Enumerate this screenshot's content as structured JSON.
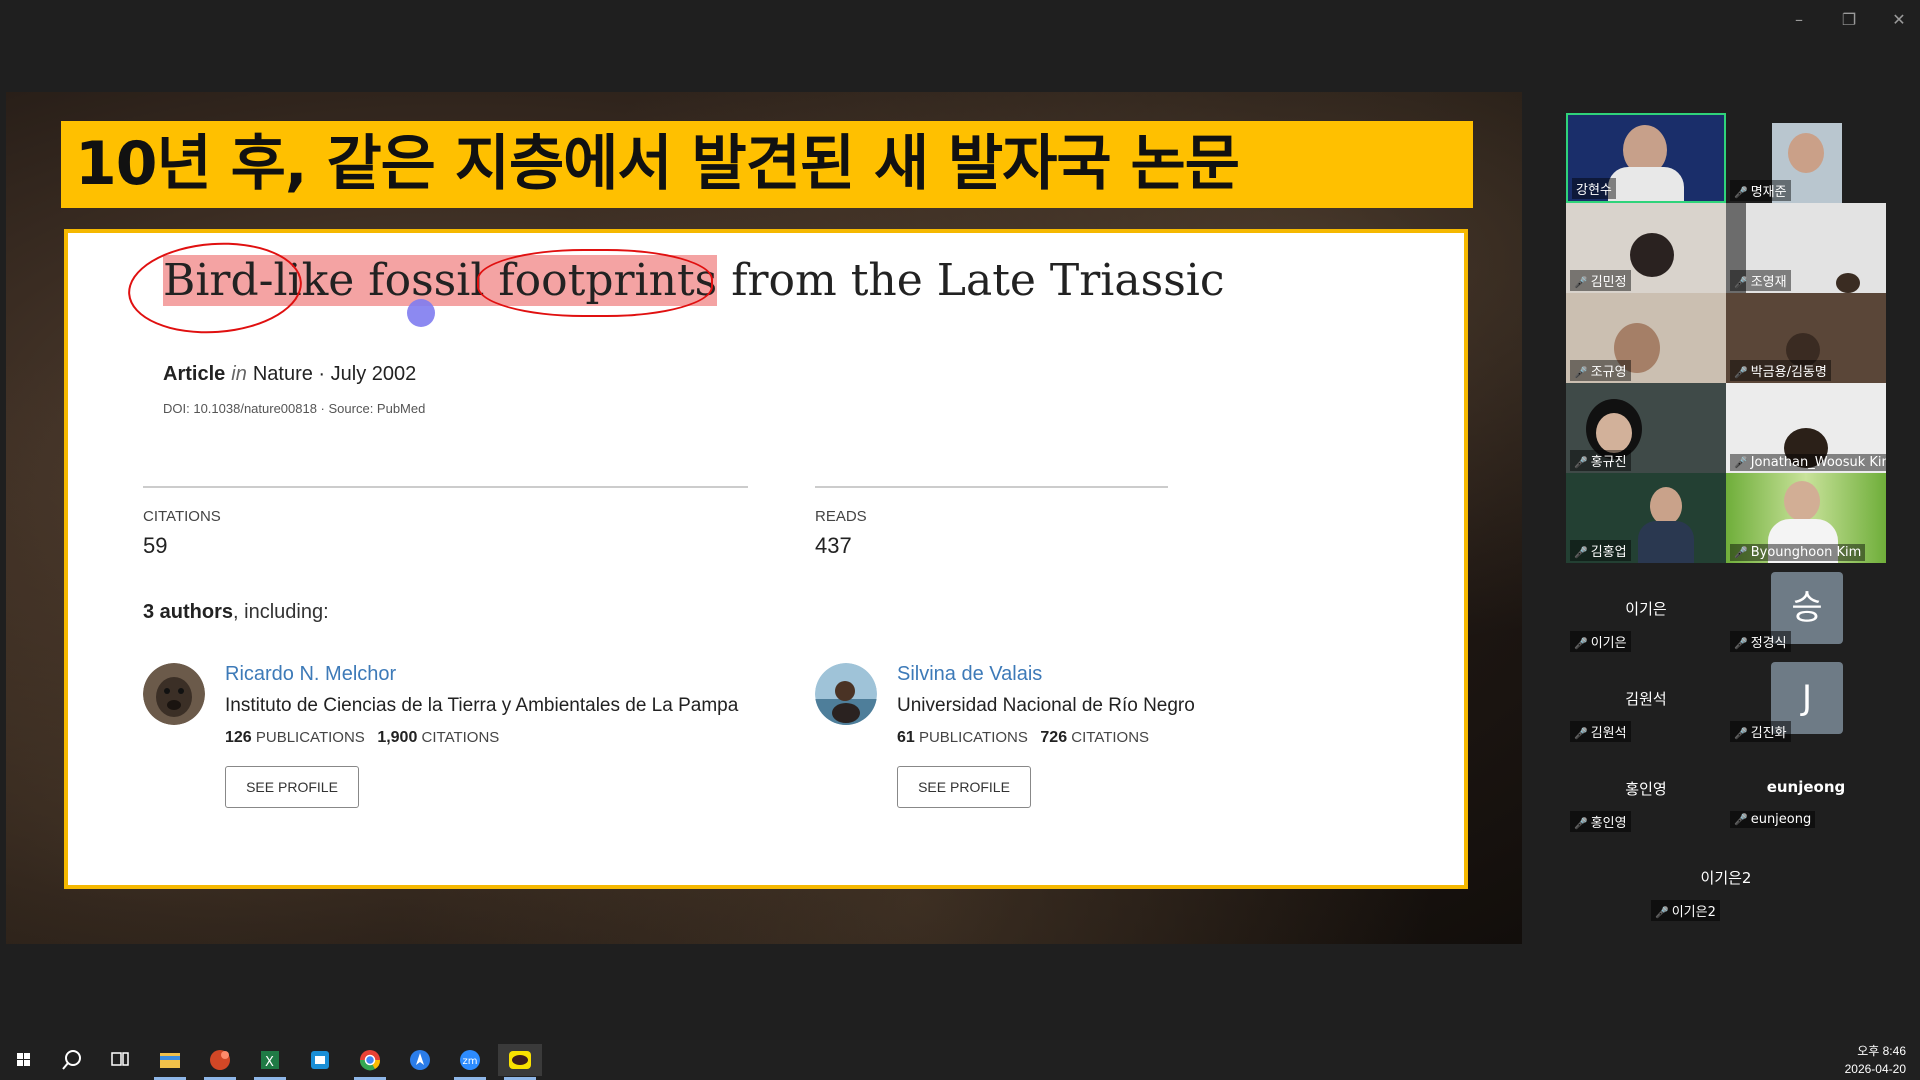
{
  "window": {
    "minimize": "–",
    "restore": "❐",
    "close": "✕"
  },
  "slide": {
    "banner": "10년 후, 같은 지층에서 발견된 새 발자국 논문",
    "title_part1": "Bird-like fossil",
    "title_part2": "footprints",
    "title_part3": " from the Late Triassic",
    "type": "Article",
    "in": "in",
    "journal": "Nature · July 2002",
    "doi": "DOI: 10.1038/nature00818 · Source: PubMed",
    "citations_label": "CITATIONS",
    "citations_value": "59",
    "reads_label": "READS",
    "reads_value": "437",
    "authors_count": "3 authors",
    "authors_suffix": ", including:",
    "authors": [
      {
        "name": "Ricardo N. Melchor",
        "institution": "Instituto de Ciencias de la Tierra y Ambientales de La Pampa",
        "pubs": "126",
        "pubs_label": "PUBLICATIONS",
        "cites": "1,900",
        "cites_label": "CITATIONS",
        "button": "SEE PROFILE"
      },
      {
        "name": "Silvina de Valais",
        "institution": "Universidad Nacional de Río Negro",
        "pubs": "61",
        "pubs_label": "PUBLICATIONS",
        "cites": "726",
        "cites_label": "CITATIONS",
        "button": "SEE PROFILE"
      }
    ]
  },
  "participants": {
    "video": [
      {
        "name": "강현수"
      },
      {
        "name": "명재준"
      },
      {
        "name": "김민정"
      },
      {
        "name": "조영재"
      },
      {
        "name": "조규영"
      },
      {
        "name": "박금용/김동명"
      },
      {
        "name": "홍규진"
      },
      {
        "name": "Jonathan_Woosuk Kim"
      },
      {
        "name": "김홍업"
      },
      {
        "name": "Byounghoon Kim"
      }
    ],
    "no_video": [
      {
        "big": "이기은",
        "small": "이기은"
      },
      {
        "initial": "승",
        "small": "정경식"
      },
      {
        "big": "김원석",
        "small": "김원석"
      },
      {
        "initial": "J",
        "small": "김진화"
      },
      {
        "big": "홍인영",
        "small": "홍인영"
      },
      {
        "big": "eunjeong",
        "small": "eunjeong"
      },
      {
        "big": "이기은2",
        "small": "이기은2"
      }
    ]
  },
  "taskbar": {
    "time": "오후 8:46",
    "date": "2026-04-20"
  }
}
